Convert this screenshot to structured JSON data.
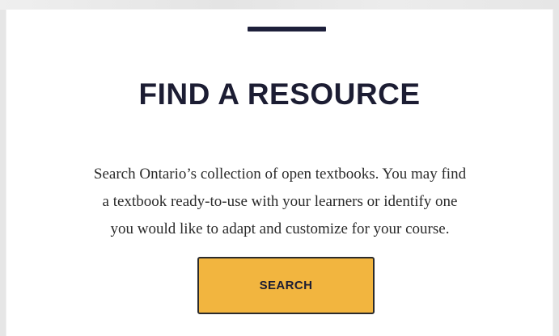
{
  "resource": {
    "heading": "FIND A RESOURCE",
    "description_lines": [
      "Search Ontario’s collection of open textbooks. You may find",
      "a textbook ready-to-use with your learners or identify one",
      "you would like to adapt and customize for your course."
    ],
    "search_button_label": "SEARCH"
  },
  "colors": {
    "accent_bar": "#1d1f3a",
    "heading_text": "#1c1d33",
    "button_fill": "#f2b53f",
    "button_border": "#2b2b2b",
    "card_background": "#ffffff",
    "page_background": "#e6e6e6"
  }
}
